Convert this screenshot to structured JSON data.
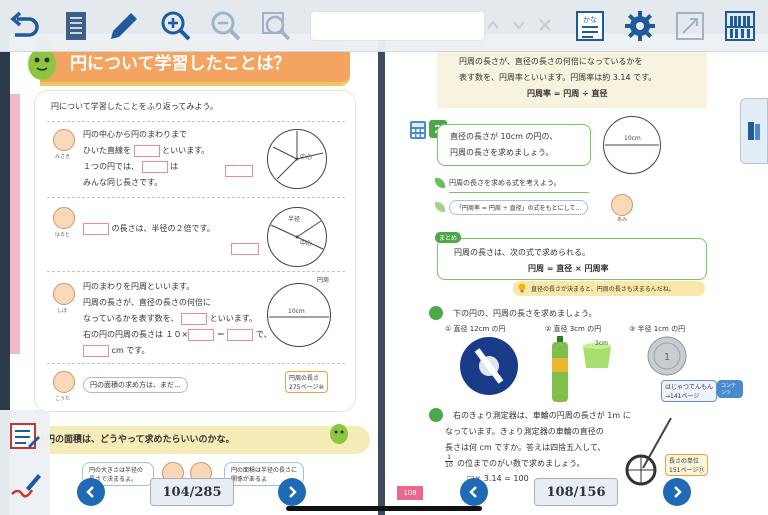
{
  "toolbar": {
    "icons": [
      "back-arrow-icon",
      "list-icon",
      "bookmark-pen-icon",
      "zoom-in-icon",
      "zoom-out-icon",
      "zoom-fit-icon",
      "chevron-up-icon",
      "chevron-down-icon",
      "close-icon",
      "kana-ruby-icon",
      "gear-icon",
      "fullscreen-icon",
      "bookshelf-icon"
    ],
    "kana_label": "かな"
  },
  "left_page": {
    "title": "円について学習したことは？",
    "intro": "円について学習したことをふり返ってみよう。",
    "sec1": {
      "line1": "円の中心から円のまわりまで",
      "line2a": "ひいた直線を",
      "line2b": "といいます。",
      "line3a": "１つの円では、",
      "line3b": "は",
      "line4": "みんな同じ長さです。",
      "name": "みさき",
      "center_label": "中心"
    },
    "sec2": {
      "line1": "の長さは、半径の２倍です。",
      "name": "はると",
      "radius_label": "半径",
      "center_label": "中心"
    },
    "sec3": {
      "line1": "円のまわりを円周といいます。",
      "line2": "円周の長さが、直径の長さの何倍に",
      "line3a": "なっているかを表す数を、",
      "line3b": "といいます。",
      "line4a": "右の円の円周の長さは １０×",
      "line4b": "＝",
      "line4c": "で、",
      "line5": "cm です。",
      "name": "しほ",
      "diameter_label": "10cm",
      "circ_label": "円周"
    },
    "sec4": {
      "bubble": "円の面積の求め方は、まだ…",
      "name": "こうた",
      "ref_line1": "円周の長さ",
      "ref_line2": "275ページ⑩"
    },
    "band_text": "円の面積は、どうやって求めたらいいのかな。",
    "bottom_left_bubble": "円の大きさは半径の長さで決まるよ。",
    "bottom_right_bubble": "円の面積は半径の長さに関係があるよ"
  },
  "right_page": {
    "def_line1": "円周の長さが、直径の長さの何倍になっているかを",
    "def_line2": "表す数を、円周率といいます。円周率は約 3.14 です。",
    "def_formula": "円周率 = 円周 ÷ 直径",
    "problem_number": "2",
    "problem_line1": "直径の長さが 10cm の円の、",
    "problem_line2": "円周の長さを求めましょう。",
    "diameter_label": "10cm",
    "think_line": "円周の長さを求める式を考えよう。",
    "hint_bubble": "「円周率 = 円周 ÷ 直径」の式をもとにして…",
    "hint_name": "あみ",
    "matome_label": "まとめ",
    "summary_line1": "円周の長さは、次の式で求められる。",
    "summary_formula": "円周 = 直径 × 円周率",
    "tip_text": "直径の長さが決まると、円周の長さも決まるんだね。",
    "ex1_intro": "下の円の、円周の長さを求めましょう。",
    "ex1_items": [
      "① 直径 12cm の円",
      "② 直径 3cm の円",
      "③ 半径 1cm の円"
    ],
    "cup_label": "3cm",
    "ex2_line1": "右のきょり測定器は、車輪の円周の長さが 1m に",
    "ex2_line2": "なっています。きょり測定器の車輪の直径の",
    "ex2_line3": "長さは何 cm ですか。答えは四捨五入して、",
    "ex2_line4": "の位までのがい数で求めましょう。",
    "ex2_frac_top": "1",
    "ex2_frac_bottom": "10",
    "ex2_eq": "□× 3.14 = 100",
    "ref_pill1": "はじゃつてんもん",
    "ref_pill2": "→141ページ",
    "ref_pill3": "コンテンツ",
    "unit_pill1": "長さの単位",
    "unit_pill2": "151ページ⑪",
    "page_number": "108"
  },
  "nav": {
    "left_indicator": "104/285",
    "right_indicator": "108/156"
  },
  "colors": {
    "accent_blue": "#1e6ab4",
    "title_orange": "#f3a460",
    "green": "#4ca84a"
  }
}
